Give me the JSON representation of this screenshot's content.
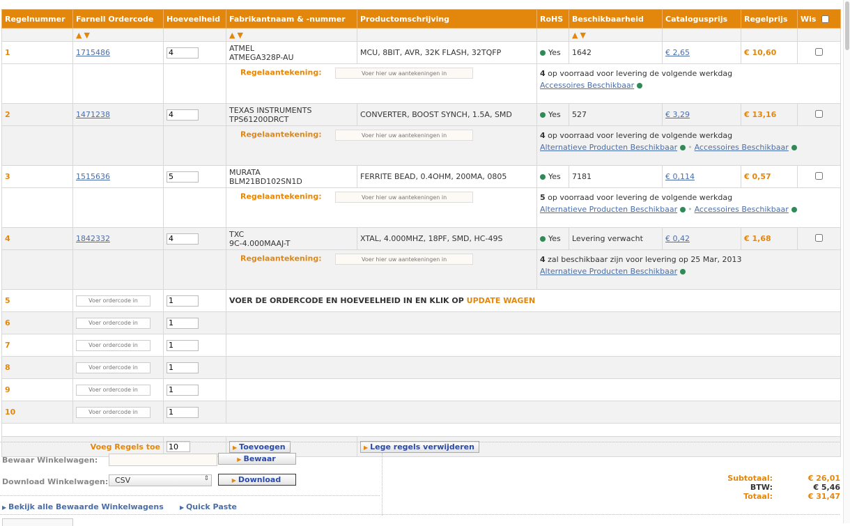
{
  "headers": [
    "Regelnummer",
    "Farnell Ordercode",
    "Hoeveelheid",
    "Fabrikantnaam & -nummer",
    "Productomschrijving",
    "RoHS",
    "Beschikbaarheid",
    "Catalogusprijs",
    "Regelprijs",
    "Wis"
  ],
  "sort_arrows": "▲▼",
  "note_label": "Regelaantekening:",
  "note_placeholder": "Voer hier uw aantekeningen in",
  "items": [
    {
      "num": "1",
      "code": "1715486",
      "qty": "4",
      "maker": "ATMEL",
      "part": "ATMEGA328P-AU",
      "desc": "MCU, 8BIT, AVR, 32K FLASH, 32TQFP",
      "rohs": "Yes",
      "avail": "1642",
      "catprice": "€ 2,65",
      "lineprice": "€ 10,60",
      "stock_num": "4",
      "stock_text": " op voorraad voor levering de volgende werkdag",
      "links": [
        "Accessoires Beschikbaar"
      ]
    },
    {
      "num": "2",
      "code": "1471238",
      "qty": "4",
      "maker": "TEXAS INSTRUMENTS",
      "part": "TPS61200DRCT",
      "desc": "CONVERTER, BOOST SYNCH, 1.5A, SMD",
      "rohs": "Yes",
      "avail": "527",
      "catprice": "€ 3,29",
      "lineprice": "€ 13,16",
      "stock_num": "4",
      "stock_text": " op voorraad voor levering de volgende werkdag",
      "links": [
        "Alternatieve Producten Beschikbaar",
        "Accessoires Beschikbaar"
      ]
    },
    {
      "num": "3",
      "code": "1515636",
      "qty": "5",
      "maker": "MURATA",
      "part": "BLM21BD102SN1D",
      "desc": "FERRITE BEAD, 0.4OHM, 200MA, 0805",
      "rohs": "Yes",
      "avail": "7181",
      "catprice": "€ 0,114",
      "lineprice": "€ 0,57",
      "stock_num": "5",
      "stock_text": " op voorraad voor levering de volgende werkdag",
      "links": [
        "Alternatieve Producten Beschikbaar",
        "Accessoires Beschikbaar"
      ]
    },
    {
      "num": "4",
      "code": "1842332",
      "qty": "4",
      "maker": "TXC",
      "part": "9C-4.000MAAJ-T",
      "desc": "XTAL, 4.000MHZ, 18PF, SMD, HC-49S",
      "rohs": "Yes",
      "avail": "Levering verwacht",
      "catprice": "€ 0,42",
      "lineprice": "€ 1,68",
      "stock_num": "4",
      "stock_text": " zal beschikbaar zijn voor levering op 25 Mar, 2013",
      "links": [
        "Alternatieve Producten Beschikbaar"
      ]
    }
  ],
  "empty_rows": [
    {
      "num": "5",
      "qty": "1"
    },
    {
      "num": "6",
      "qty": "1"
    },
    {
      "num": "7",
      "qty": "1"
    },
    {
      "num": "8",
      "qty": "1"
    },
    {
      "num": "9",
      "qty": "1"
    },
    {
      "num": "10",
      "qty": "1"
    }
  ],
  "code_placeholder": "Voer ordercode in",
  "instruction_prefix": "VOER DE ORDERCODE EN HOEVEELHEID IN EN KLIK OP ",
  "instruction_highlight": "UPDATE WAGEN",
  "add_rows": {
    "label": "Voeg Regels toe",
    "value": "10",
    "add_button": "Toevoegen",
    "remove_button": "Lege regels verwijderen"
  },
  "save_cart": {
    "label": "Bewaar Winkelwagen:",
    "button": "Bewaar"
  },
  "download_cart": {
    "label": "Download Winkelwagen:",
    "format": "CSV",
    "button": "Download"
  },
  "links": {
    "view_saved": "Bekijk alle Bewaarde Winkelwagens",
    "quick_paste": "Quick Paste"
  },
  "totals": {
    "subtotal_label": "Subtotaal:",
    "subtotal": "€ 26,01",
    "vat_label": "BTW:",
    "vat": "€ 5,46",
    "total_label": "Totaal:",
    "total": "€ 31,47"
  },
  "colors": {
    "accent": "#e3870c",
    "link": "#4a6ea8",
    "stock_dot": "#2e8b57"
  }
}
